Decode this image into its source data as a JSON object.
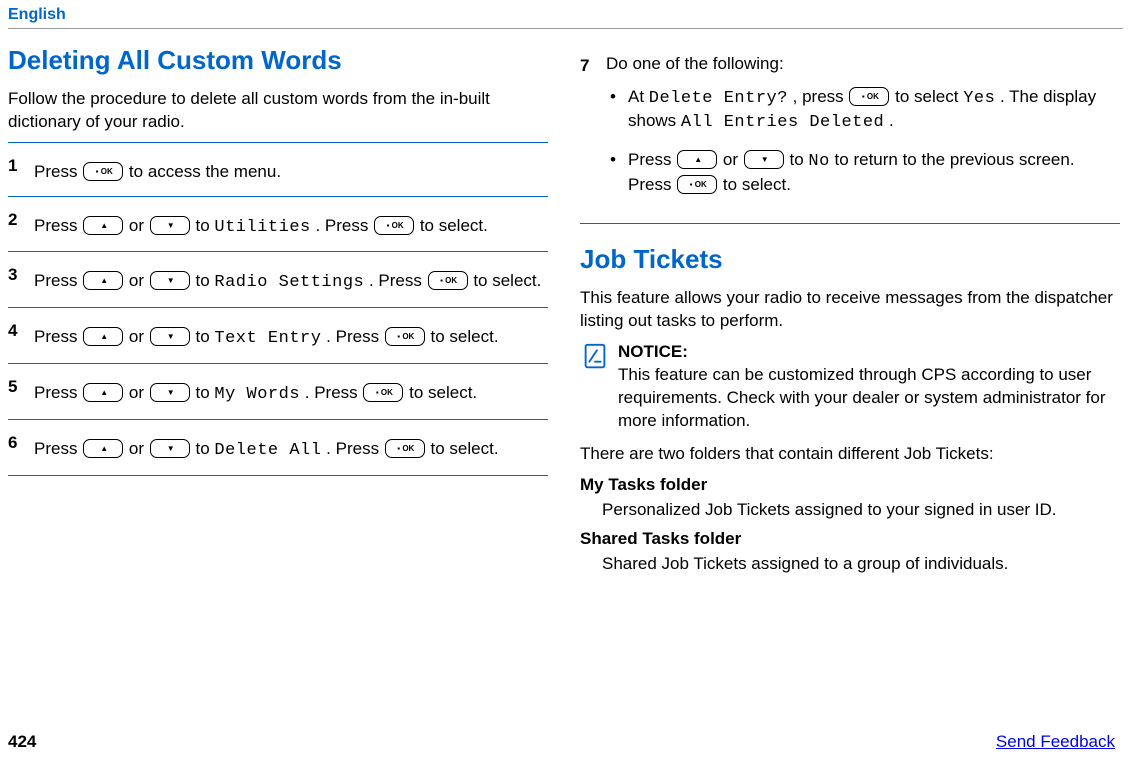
{
  "header": {
    "lang": "English"
  },
  "left": {
    "title": "Deleting All Custom Words",
    "intro": "Follow the procedure to delete all custom words from the in-built dictionary of your radio.",
    "steps": {
      "s1": {
        "num": "1",
        "a": "Press ",
        "b": " to access the menu."
      },
      "s2": {
        "num": "2",
        "a": "Press ",
        "b": " or ",
        "c": " to ",
        "target": "Utilities",
        "d": ". Press ",
        "e": " to select."
      },
      "s3": {
        "num": "3",
        "a": "Press ",
        "b": " or ",
        "c": " to ",
        "target": "Radio Settings",
        "d": ". Press ",
        "e": " to select."
      },
      "s4": {
        "num": "4",
        "a": "Press ",
        "b": " or ",
        "c": " to ",
        "target": "Text Entry",
        "d": ". Press ",
        "e": " to select."
      },
      "s5": {
        "num": "5",
        "a": "Press ",
        "b": " or ",
        "c": " to ",
        "target": "My Words",
        "d": ". Press ",
        "e": " to select."
      },
      "s6": {
        "num": "6",
        "a": "Press ",
        "b": " or ",
        "c": " to ",
        "target": "Delete All",
        "d": ". Press ",
        "e": " to select."
      }
    }
  },
  "right": {
    "step7": {
      "num": "7",
      "lead": "Do one of the following:",
      "b1": {
        "a": "At ",
        "prompt": "Delete Entry?",
        "b": ", press ",
        "c": " to select ",
        "yes": "Yes",
        "d": ". The display shows ",
        "msg": "All Entries Deleted",
        "e": "."
      },
      "b2": {
        "a": "Press ",
        "b": " or ",
        "c": " to ",
        "no": "No",
        "d": " to return to the previous screen. Press ",
        "e": " to select."
      }
    },
    "jobtix": {
      "title": "Job Tickets",
      "intro": "This feature allows your radio to receive messages from the dispatcher listing out tasks to perform.",
      "notice_label": "NOTICE:",
      "notice_body": "This feature can be customized through CPS according to user requirements. Check with your dealer or system administrator for more information.",
      "folders_lead": "There are two folders that contain different Job Tickets:",
      "f1_title": "My Tasks folder",
      "f1_desc": "Personalized Job Tickets assigned to your signed in user ID.",
      "f2_title": "Shared Tasks folder",
      "f2_desc": "Shared Job Tickets assigned to a group of individuals."
    }
  },
  "footer": {
    "page": "424",
    "feedback": "Send Feedback"
  }
}
